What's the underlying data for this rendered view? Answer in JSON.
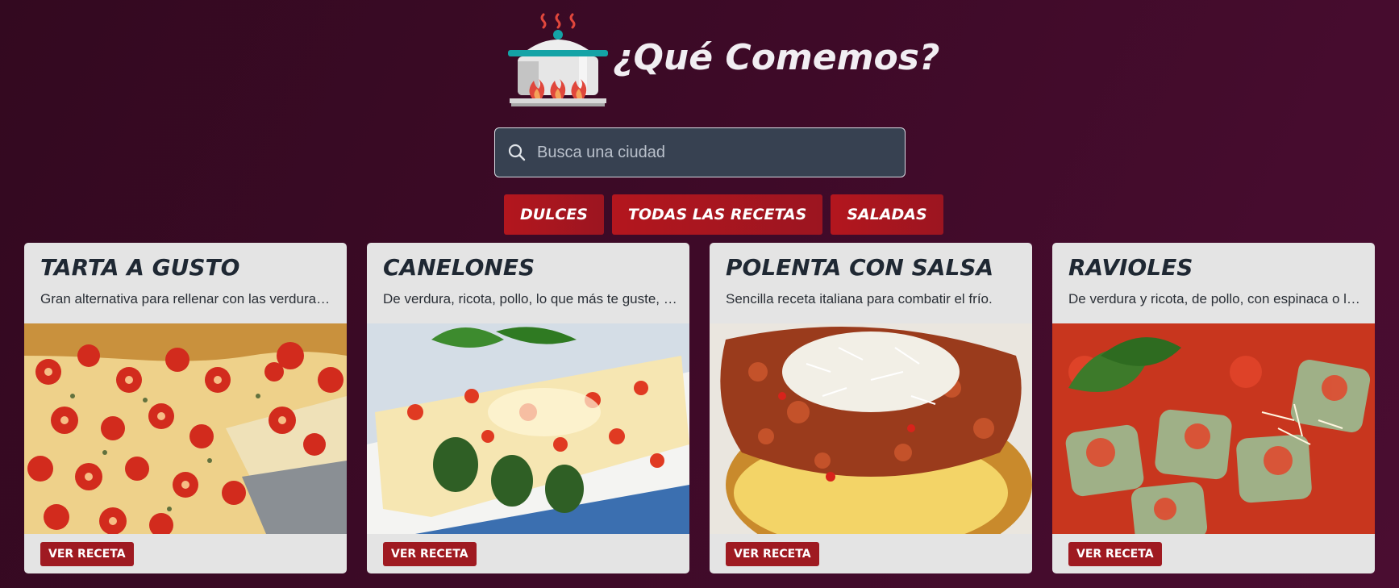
{
  "header": {
    "title": "¿Qué Comemos?",
    "logo_icon": "cooking-pot-icon"
  },
  "search": {
    "placeholder": "Busca una ciudad",
    "value": "",
    "icon": "search-icon"
  },
  "filters": [
    {
      "label": "DULCES"
    },
    {
      "label": "TODAS LAS RECETAS"
    },
    {
      "label": "SALADAS"
    }
  ],
  "cards": [
    {
      "title": "TARTA A GUSTO",
      "description": "Gran alternativa para rellenar con las verduras que tengas en casa.",
      "button": "VER RECETA"
    },
    {
      "title": "CANELONES",
      "description": "De verdura, ricota, pollo, lo que más te guste, con salsa.",
      "button": "VER RECETA"
    },
    {
      "title": "POLENTA CON SALSA",
      "description": "Sencilla receta italiana para combatir el frío.",
      "button": "VER RECETA"
    },
    {
      "title": "RAVIOLES",
      "description": "De verdura y ricota, de pollo, con espinaca o lo que quieras.",
      "button": "VER RECETA"
    }
  ],
  "colors": {
    "background": "#3d0a27",
    "accent_button": "#b3161e",
    "card_bg": "#e4e4e4",
    "title_text": "#1f2833"
  }
}
